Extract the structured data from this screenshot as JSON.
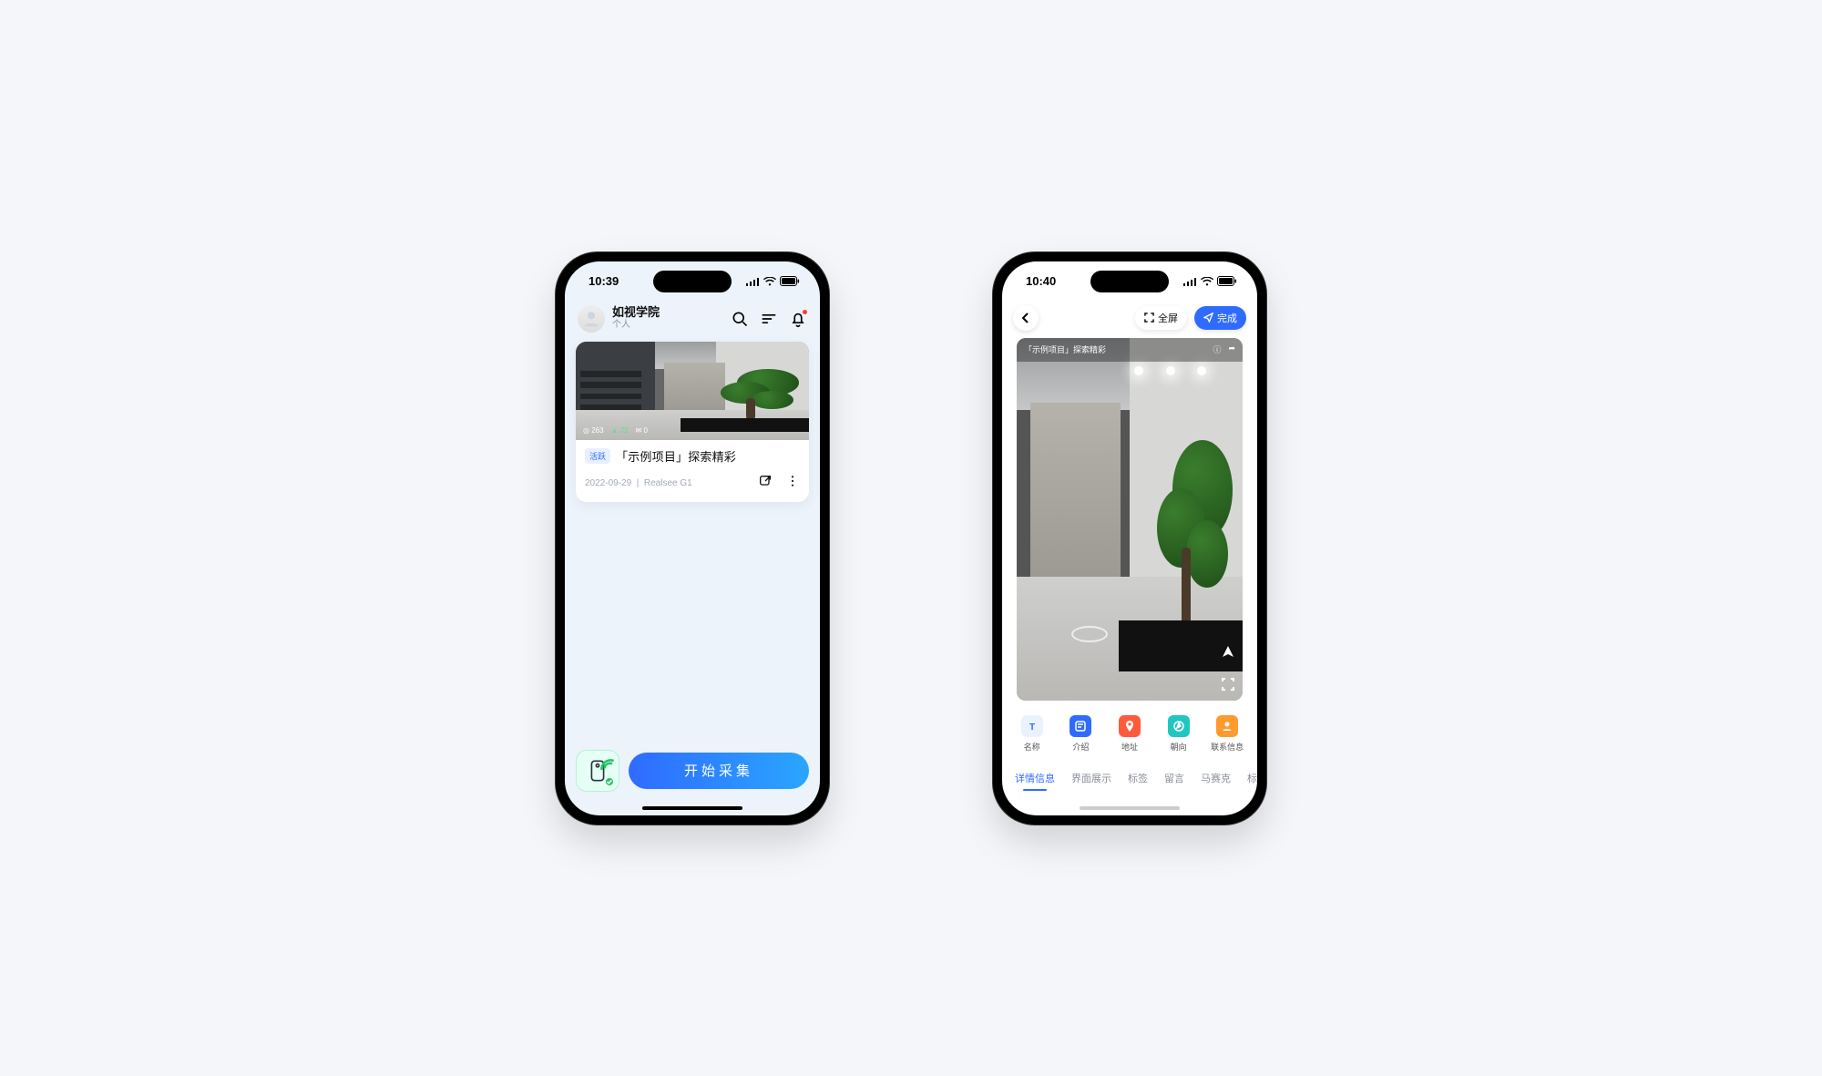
{
  "phone1": {
    "status_time": "10:39",
    "user_name": "如视学院",
    "user_sub": "个人",
    "card": {
      "badge": "活跃",
      "title": "「示例项目」探索精彩",
      "date": "2022-09-29",
      "device": "Realsee G1",
      "views": "263",
      "people": "72",
      "comments": "0"
    },
    "start_button": "开始采集"
  },
  "phone2": {
    "status_time": "10:40",
    "fullscreen_label": "全屏",
    "done_label": "完成",
    "preview_title": "「示例项目」探索精彩",
    "action_icons": [
      {
        "label": "名称",
        "color": "#2f6bff"
      },
      {
        "label": "介绍",
        "color": "#2f6bff"
      },
      {
        "label": "地址",
        "color": "#ff5a3c"
      },
      {
        "label": "朝向",
        "color": "#1fc7c0"
      },
      {
        "label": "联系信息",
        "color": "#ff9a2e"
      }
    ],
    "tabs": [
      "详情信息",
      "界面展示",
      "标签",
      "留言",
      "马赛克",
      "标"
    ]
  }
}
